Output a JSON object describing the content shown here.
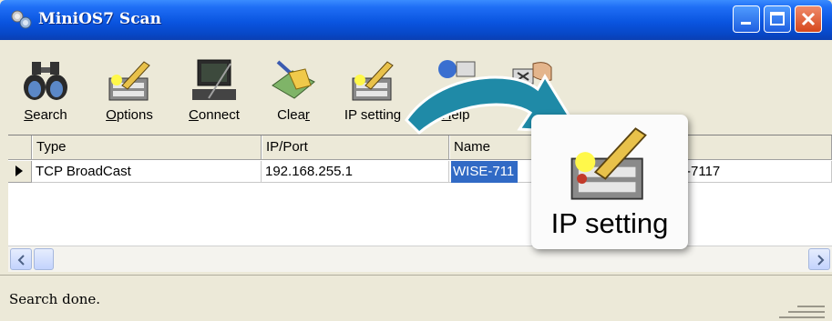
{
  "window": {
    "title": "MiniOS7 Scan",
    "colors": {
      "titlebar": "#0a55e0",
      "selection": "#316ac5",
      "arrow": "#1f8aa7"
    }
  },
  "toolbar": {
    "items": [
      {
        "pre": "",
        "accel": "S",
        "post": "earch",
        "icon": "binoculars-icon"
      },
      {
        "pre": "",
        "accel": "O",
        "post": "ptions",
        "icon": "options-pen-icon"
      },
      {
        "pre": "",
        "accel": "C",
        "post": "onnect",
        "icon": "computer-connect-icon"
      },
      {
        "pre": "Clea",
        "accel": "r",
        "post": "",
        "icon": "broom-clear-icon"
      },
      {
        "pre": "IP setting",
        "accel": "",
        "post": "",
        "icon": "ip-setting-icon"
      },
      {
        "pre": "",
        "accel": "H",
        "post": "elp",
        "icon": "help-icon"
      },
      {
        "pre": "",
        "accel": "",
        "post": "",
        "icon": "exit-hand-icon"
      }
    ]
  },
  "table": {
    "columns": [
      "Type",
      "IP/Port",
      "Name",
      ""
    ],
    "rows": [
      {
        "type": "TCP BroadCast",
        "ip": "192.168.255.1",
        "name": "WISE-711",
        "extra": "-7117"
      }
    ]
  },
  "status": {
    "text": "Search done."
  },
  "callout": {
    "label": "IP setting",
    "icon": "ip-setting-icon"
  }
}
